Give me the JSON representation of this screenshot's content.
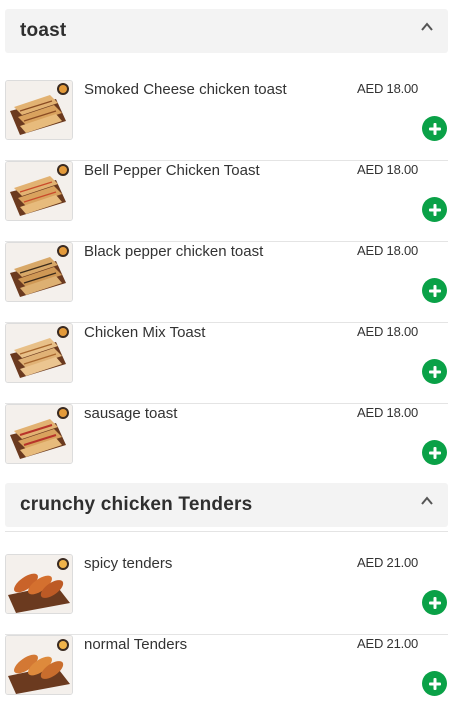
{
  "sections": [
    {
      "title": "toast",
      "items": [
        {
          "name": "Smoked Cheese chicken toast",
          "price": "AED 18.00",
          "image": "toast-food-photo"
        },
        {
          "name": "Bell Pepper Chicken Toast",
          "price": "AED 18.00",
          "image": "toast-food-photo"
        },
        {
          "name": "Black pepper chicken toast",
          "price": "AED 18.00",
          "image": "toast-food-photo"
        },
        {
          "name": "Chicken Mix Toast",
          "price": "AED 18.00",
          "image": "toast-food-photo"
        },
        {
          "name": "sausage toast",
          "price": "AED 18.00",
          "image": "toast-food-photo"
        }
      ]
    },
    {
      "title": "crunchy chicken Tenders",
      "items": [
        {
          "name": "spicy tenders",
          "price": "AED 21.00",
          "image": "tenders-food-photo"
        },
        {
          "name": "normal Tenders",
          "price": "AED 21.00",
          "image": "tenders-food-photo"
        }
      ]
    }
  ],
  "icons": {
    "collapse": "chevron-up-icon",
    "add": "plus-circle-icon"
  },
  "colors": {
    "add_button": "#0aa147",
    "section_header_bg": "#f3f3f3"
  }
}
